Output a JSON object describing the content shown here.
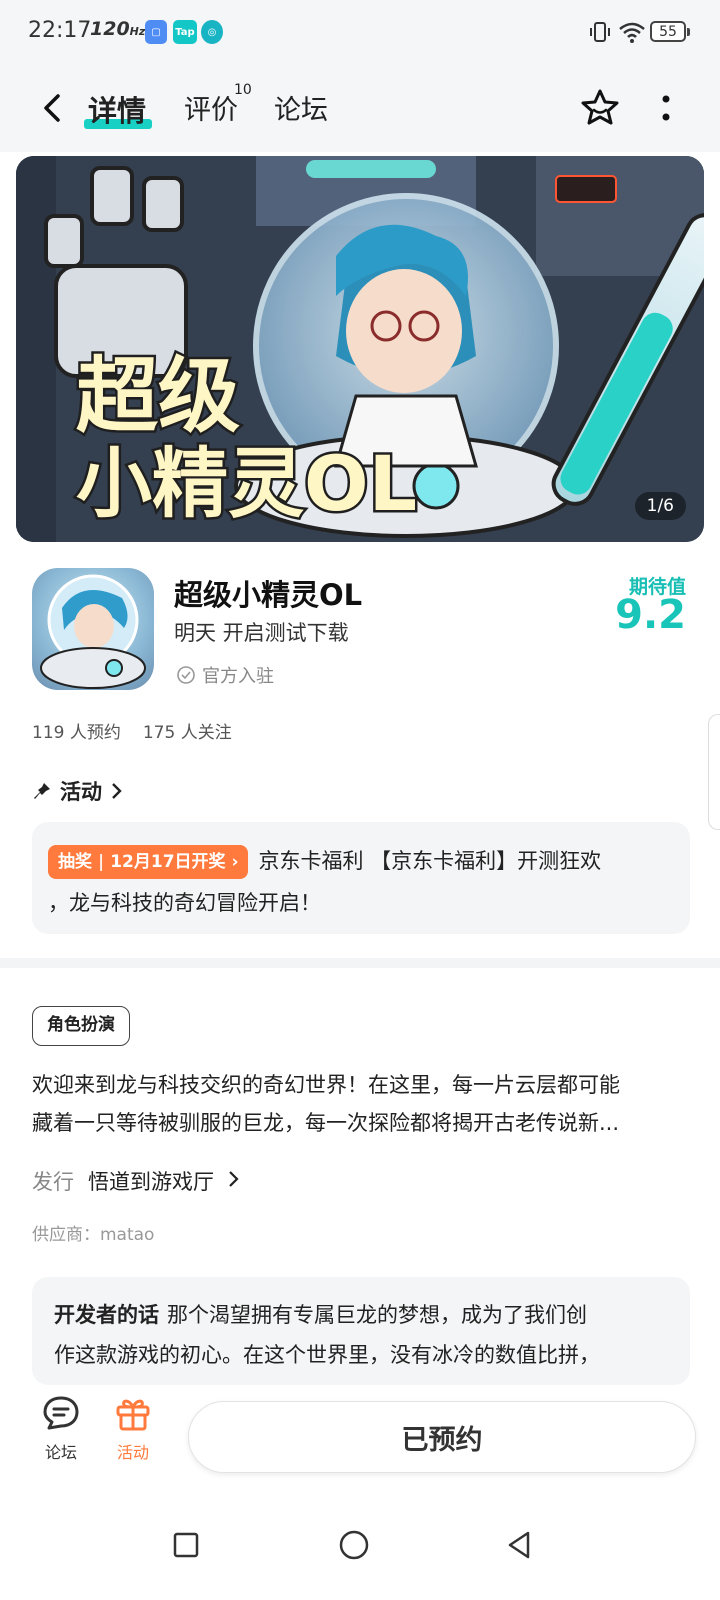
{
  "status_bar": {
    "time": "22:17",
    "refresh_rate": "120",
    "refresh_unit": "Hz",
    "battery": "55",
    "app_icons": [
      "app-store-icon",
      "taptap-icon",
      "cleaner-icon"
    ]
  },
  "nav": {
    "tabs": [
      {
        "label": "详情"
      },
      {
        "label": "评价"
      },
      {
        "label": "论坛"
      }
    ],
    "review_count": "10",
    "accent_color": "#19d0c5"
  },
  "banner": {
    "counter": "1/6",
    "logo_text": "超级小精灵OL"
  },
  "app": {
    "title": "超级小精灵OL",
    "subtitle": "明天 开启测试下载",
    "official": "官方入驻",
    "expect_label": "期待值",
    "expect_value": "9.2",
    "reservations": "119 人预约",
    "followers": "175 人关注"
  },
  "activity": {
    "header": "活动",
    "tag_type": "抽奖",
    "tag_date": "12月17日开奖",
    "text_line1": "京东卡福利 【京东卡福利】开测狂欢",
    "text_line2": "，龙与科技的奇幻冒险开启！"
  },
  "description": {
    "genre": "角色扮演",
    "intro_line1": "欢迎来到龙与科技交织的奇幻世界！在这里，每一片云层都可能",
    "intro_line2": "藏着一只等待被驯服的巨龙，每一次探险都将揭开古老传说新...",
    "publisher_label": "发行",
    "publisher_name": "悟道到游戏厅",
    "supplier": "供应商：matao"
  },
  "developer": {
    "label": "开发者的话",
    "line1": "那个渴望拥有专属巨龙的梦想，成为了我们创",
    "line2": "作这款游戏的初心。在这个世界里，没有冰冷的数值比拼，"
  },
  "bottom_bar": {
    "forum_label": "论坛",
    "activity_label": "活动",
    "reserve_button": "已预约",
    "activity_color": "#ff7a3c"
  }
}
